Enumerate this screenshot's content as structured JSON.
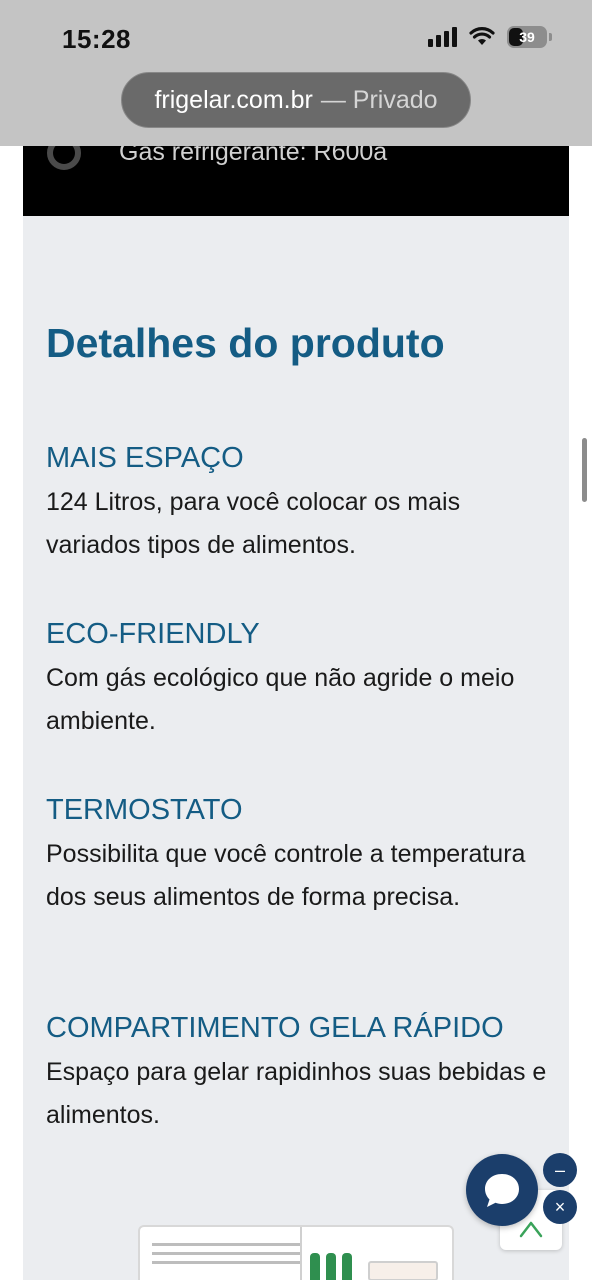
{
  "status_bar": {
    "time": "15:28",
    "battery": "39"
  },
  "browser": {
    "url": "frigelar.com.br",
    "mode": "— Privado"
  },
  "specs_tail": {
    "text": "Gás refrigerante: R600a"
  },
  "details": {
    "title": "Detalhes do produto",
    "features": [
      {
        "heading": "MAIS ESPAÇO",
        "text": "124 Litros, para você colocar os mais variados tipos de alimentos."
      },
      {
        "heading": "ECO-FRIENDLY",
        "text": "Com gás ecológico que não agride o meio ambiente."
      },
      {
        "heading": "TERMOSTATO",
        "text": "Possibilita que você controle a temperatura dos seus alimentos de forma precisa."
      },
      {
        "heading": "COMPARTIMENTO GELA RÁPIDO",
        "text": "Espaço para gelar rapidinhos suas bebidas e alimentos."
      }
    ]
  },
  "widgets": {
    "minimize_label": "–",
    "close_label": "×"
  },
  "colors": {
    "accent": "#145c84",
    "chat": "#1b3e6b",
    "panel_bg": "#ebedf0"
  },
  "icons": [
    "signal-icon",
    "wifi-icon",
    "battery-icon",
    "chat-icon",
    "chevron-up-icon"
  ]
}
